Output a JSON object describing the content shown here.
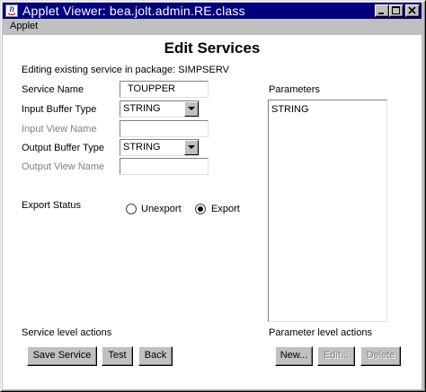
{
  "window": {
    "title": "Applet Viewer: bea.jolt.admin.RE.class",
    "menu": [
      "Applet"
    ]
  },
  "page": {
    "heading": "Edit Services",
    "info": "Editing existing service in package: SIMPSERV"
  },
  "form": {
    "service_name_label": "Service Name",
    "service_name_value": "TOUPPER",
    "input_buffer_label": "Input Buffer Type",
    "input_buffer_value": "STRING",
    "input_view_label": "Input View Name",
    "input_view_value": "",
    "output_buffer_label": "Output Buffer Type",
    "output_buffer_value": "STRING",
    "output_view_label": "Output View Name",
    "output_view_value": "",
    "export_status_label": "Export Status",
    "unexport_label": "Unexport",
    "export_label": "Export",
    "export_selected": "Export"
  },
  "parameters": {
    "label": "Parameters",
    "items": [
      "STRING"
    ]
  },
  "service_actions": {
    "label": "Service level actions",
    "save": "Save Service",
    "test": "Test",
    "back": "Back"
  },
  "parameter_actions": {
    "label": "Parameter level actions",
    "new": "New...",
    "edit": "Edit...",
    "delete": "Delete"
  }
}
